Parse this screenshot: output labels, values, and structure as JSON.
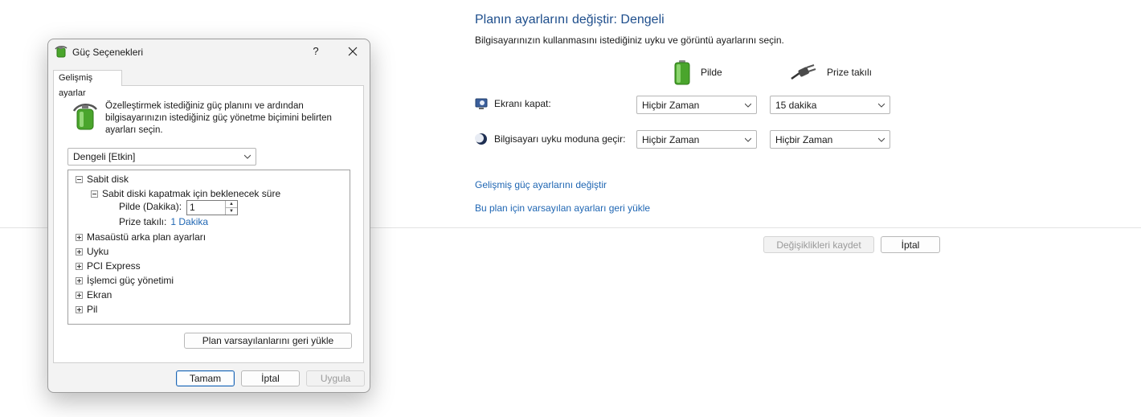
{
  "settings": {
    "title": "Planın ayarlarını değiştir: Dengeli",
    "subtitle": "Bilgisayarınızın kullanmasını istediğiniz uyku ve görüntü ayarlarını seçin.",
    "col_battery": "Pilde",
    "col_plugged": "Prize takılı",
    "rows": [
      {
        "label": "Ekranı kapat:",
        "icon": "monitor-icon",
        "battery": "Hiçbir Zaman",
        "plugged": "15 dakika"
      },
      {
        "label": "Bilgisayarı uyku moduna geçir:",
        "icon": "moon-icon",
        "battery": "Hiçbir Zaman",
        "plugged": "Hiçbir Zaman"
      }
    ],
    "link_advanced": "Gelişmiş güç ayarlarını değiştir",
    "link_restore": "Bu plan için varsayılan ayarları geri yükle",
    "save_label": "Değişiklikleri kaydet",
    "cancel_label": "İptal"
  },
  "dialog": {
    "title": "Güç Seçenekleri",
    "help": "?",
    "tab": "Gelişmiş ayarlar",
    "intro": "Özelleştirmek istediğiniz güç planını ve ardından bilgisayarınızın istediğiniz güç yönetme biçimini belirten ayarları seçin.",
    "plan_selected": "Dengeli [Etkin]",
    "tree": {
      "sabit_disk": "Sabit disk",
      "sabit_disk_kapat": "Sabit diski kapatmak için beklenecek süre",
      "pilde_label": "Pilde (Dakika):",
      "pilde_value": "1",
      "prize_label": "Prize takılı:",
      "prize_value": "1 Dakika",
      "masaustu": "Masaüstü arka plan ayarları",
      "uyku": "Uyku",
      "pci": "PCI Express",
      "islemci": "İşlemci güç yönetimi",
      "ekran": "Ekran",
      "pil": "Pil"
    },
    "restore_defaults": "Plan varsayılanlarını geri yükle",
    "ok": "Tamam",
    "cancel": "İptal",
    "apply": "Uygula"
  },
  "colors": {
    "link": "#1f66b3",
    "title": "#1e4e8c",
    "battery_green": "#5bbd3a"
  }
}
